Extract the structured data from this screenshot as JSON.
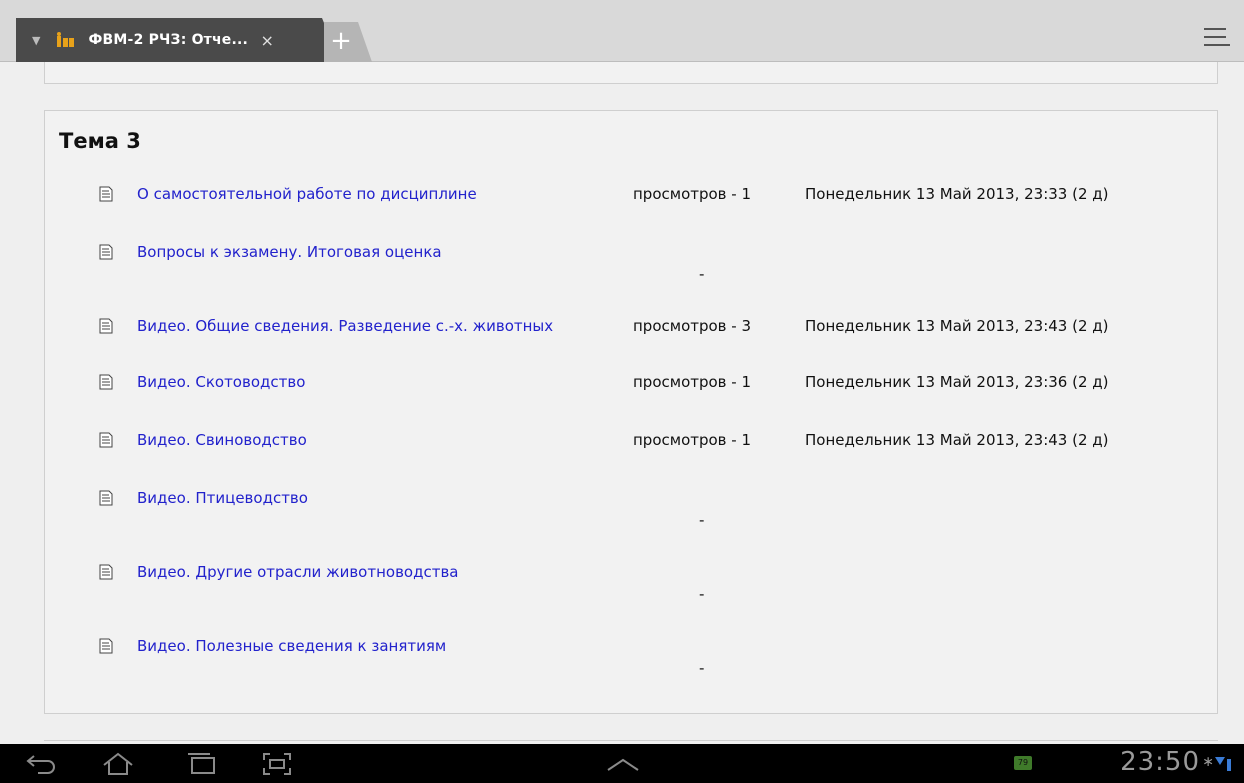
{
  "browser": {
    "tab_title": "ФВМ-2 РЧЗ: Отче...",
    "close_glyph": "×",
    "new_tab_glyph": "+"
  },
  "section": {
    "heading": "Тема 3",
    "rows": [
      {
        "link": "О самостоятельной работе по дисциплине",
        "views": "просмотров - 1",
        "dash": "",
        "date": "Понедельник 13 Май 2013, 23:33 (2 д)"
      },
      {
        "link": "Вопросы к экзамену. Итоговая оценка",
        "views": "",
        "dash": "-",
        "date": ""
      },
      {
        "link": "Видео. Общие сведения. Разведение с.-х. животных",
        "views": "просмотров - 3",
        "dash": "",
        "date": "Понедельник 13 Май 2013, 23:43 (2 д)"
      },
      {
        "link": "Видео. Скотоводство",
        "views": "просмотров - 1",
        "dash": "",
        "date": "Понедельник 13 Май 2013, 23:36 (2 д)"
      },
      {
        "link": "Видео. Свиноводство",
        "views": "просмотров - 1",
        "dash": "",
        "date": "Понедельник 13 Май 2013, 23:43 (2 д)"
      },
      {
        "link": "Видео. Птицеводство",
        "views": "",
        "dash": "-",
        "date": ""
      },
      {
        "link": "Видео. Другие отрасли животноводства",
        "views": "",
        "dash": "-",
        "date": ""
      },
      {
        "link": "Видео. Полезные сведения к занятиям",
        "views": "",
        "dash": "-",
        "date": ""
      }
    ]
  },
  "status_bar": {
    "time": "23:50",
    "notification_badge": "79"
  },
  "icons": {
    "back": "back-icon",
    "home": "home-icon",
    "recent": "recent-apps-icon",
    "screenshot": "screenshot-icon",
    "up": "chevron-up-icon",
    "bluetooth": "bluetooth-icon",
    "wifi": "wifi-icon",
    "battery": "battery-icon",
    "document": "document-icon"
  },
  "colors": {
    "link": "#2222cc",
    "tab": "#4a4a4a",
    "system_bar": "#000000"
  }
}
